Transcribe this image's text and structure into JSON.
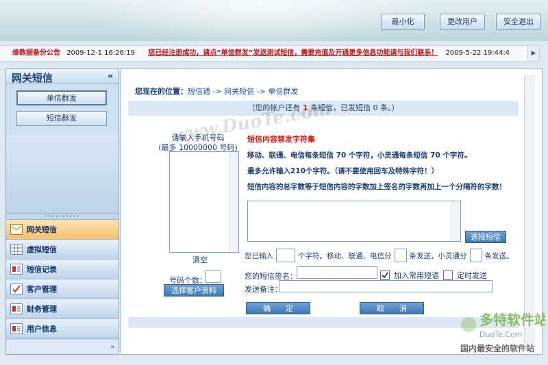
{
  "header": {
    "buttons": [
      "最小化",
      "更改用户",
      "安全退出"
    ]
  },
  "ticker": {
    "title": "缘数据备份公告",
    "title_time": "2009-12-1 16:26:19",
    "message": "您已经注册成功，请点“单信群发”发送测试短信，需要充值及开通更多信息功能请与我们联系！",
    "message_time": "2009-5-22 19:44:4"
  },
  "sidebar": {
    "title": "网关短信",
    "collapse": "«",
    "sub_buttons": [
      "单信群发",
      "短信群发"
    ],
    "menu": [
      "网关短信",
      "虚拟短信",
      "短信记录",
      "客户管理",
      "财务管理",
      "用户信息"
    ],
    "more": "»"
  },
  "main": {
    "crumb_label": "您现在的位置：",
    "crumb_path": "短信通 -> 网关短信 -> 单信群发",
    "status_prefix": "（您的帐户还有",
    "status_count": "1",
    "status_suffix": "条短信，已发短信 0 条。）",
    "phone_label": "请输入手机号码",
    "phone_hint": "(最多 10000000 号码)",
    "clear": "清空",
    "count_label": "号码个数：",
    "select_client": "选择客户资料",
    "rules_title": "短信内容禁发字符集",
    "rule1": "移动、联通、电信每条短信 70 个字符，小灵通每条短信 70 个字符。",
    "rule2": "最多允许输入210个字符。（请不要使用回车及特殊字符！）",
    "rule3": "短信内容的总字数等于短信内容的字数加上签名的字数再加上一个分隔符的字数！",
    "select_msg": "选择短信",
    "input_prefix": "您已输入",
    "input_mid1": "个字符。移动、联通、电信分",
    "input_mid2": "条发送，小灵通分",
    "input_suffix": "条发送。",
    "sig_label": "您的短信签名：",
    "add_common": "加入常用短语",
    "add_common_checked": true,
    "timed": "定时发送",
    "timed_checked": false,
    "note_label": "发送备注：",
    "ok": "确　　定",
    "cancel": "取　　消"
  },
  "watermark": {
    "text": "www.DuoTe.com",
    "logo_cn": "多特软件站",
    "logo_en": "DuoTe.Com",
    "slogan": "国内最安全的软件站"
  }
}
